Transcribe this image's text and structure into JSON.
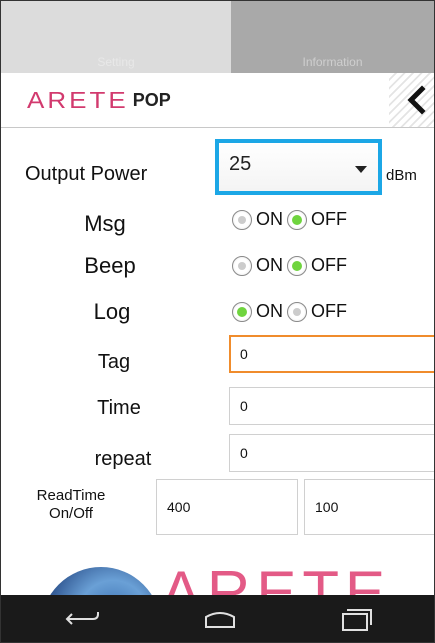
{
  "tabs": [
    {
      "label": "Setting"
    },
    {
      "label": "Information"
    }
  ],
  "header": {
    "logo_main": "ARETE",
    "logo_sub": "POP"
  },
  "output_power": {
    "label": "Output Power",
    "value": "25",
    "unit": "dBm"
  },
  "toggles": [
    {
      "label": "Msg",
      "on_label": "ON",
      "off_label": "OFF",
      "selected": "OFF"
    },
    {
      "label": "Beep",
      "on_label": "ON",
      "off_label": "OFF",
      "selected": "OFF"
    },
    {
      "label": "Log",
      "on_label": "ON",
      "off_label": "OFF",
      "selected": "ON"
    }
  ],
  "fields": {
    "tag": {
      "label": "Tag",
      "value": "0"
    },
    "time": {
      "label": "Time",
      "value": "0"
    },
    "repeat": {
      "label": "repeat",
      "value": "0"
    },
    "readtime": {
      "label_line1": "ReadTime",
      "label_line2": "On/Off",
      "on_value": "400",
      "off_value": "100"
    }
  },
  "footer_logo": "ARETE",
  "colors": {
    "accent_blue": "#1ca7e6",
    "focus_orange": "#f08c2c",
    "radio_on": "#6fd43e",
    "brand_pink": "#d23a6e"
  }
}
